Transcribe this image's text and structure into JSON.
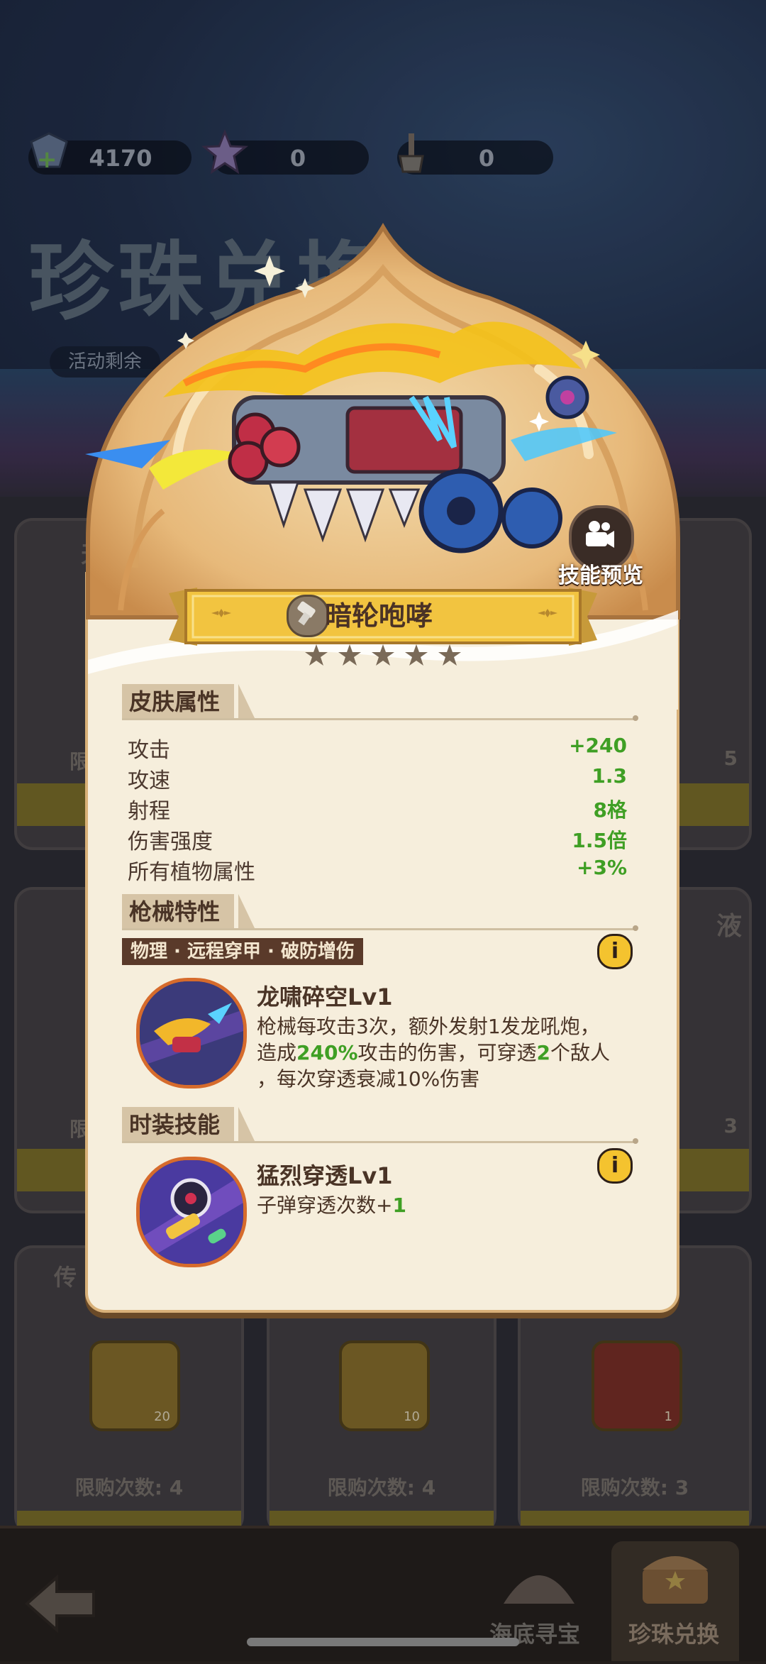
{
  "currencies": [
    {
      "icon": "pearl-gem-icon",
      "value": "4170"
    },
    {
      "icon": "star-shell-icon",
      "value": "0"
    },
    {
      "icon": "shovel-icon",
      "value": "0"
    }
  ],
  "background": {
    "title": "珍珠兑换",
    "timer_label": "活动剩余",
    "cards": [
      {
        "title": "天",
        "limit": "限购"
      },
      {
        "title": "",
        "limit": ""
      },
      {
        "title": "",
        "limit": "5"
      },
      {
        "title": "",
        "limit": "限"
      },
      {
        "title": "",
        "limit": ""
      },
      {
        "title": "液",
        "limit": "3"
      }
    ],
    "bottom_cards": [
      {
        "title": "传",
        "limit": "限购次数: 4",
        "item_count": "20"
      },
      {
        "title": "",
        "limit": "限购次数: 4",
        "item_count": "10"
      },
      {
        "title": "",
        "limit": "限购次数: 3",
        "item_count": "1"
      }
    ]
  },
  "bottom_nav": {
    "back_label": "",
    "tabs": [
      {
        "label": "海底寻宝",
        "active": false
      },
      {
        "label": "珍珠兑换",
        "active": true
      }
    ]
  },
  "dialog": {
    "skin_name": "暗轮咆哮",
    "stars": 5,
    "skill_preview_label": "技能预览",
    "attributes_title": "皮肤属性",
    "attributes": [
      {
        "label": "攻击",
        "value": "+240"
      },
      {
        "label": "攻速",
        "value": "1.3"
      },
      {
        "label": "射程",
        "value": "8格"
      },
      {
        "label": "伤害强度",
        "value": "1.5倍"
      },
      {
        "label": "所有植物属性",
        "value": "+3%"
      }
    ],
    "gun_traits_title": "枪械特性",
    "gun_tag": "物理 · 远程穿甲 · 破防增伤",
    "gun_skill": {
      "name": "龙啸碎空Lv1",
      "desc_1": "枪械每攻击3次，额外发射1发龙吼炮，",
      "desc_2a": "造成",
      "desc_2b": "240%",
      "desc_2c": "攻击的伤害，可穿透",
      "desc_2d": "2",
      "desc_2e": "个敌人",
      "desc_3": "，每次穿透衰减10%伤害"
    },
    "costume_title": "时装技能",
    "costume_skill": {
      "name": "猛烈穿透Lv1",
      "desc_a": "子弹穿透次数+",
      "desc_b": "1"
    },
    "info_glyph": "i"
  },
  "colors": {
    "value_green": "#3f9f24",
    "dialog_bg": "#f6eedc",
    "banner_gold": "#f2c440"
  }
}
